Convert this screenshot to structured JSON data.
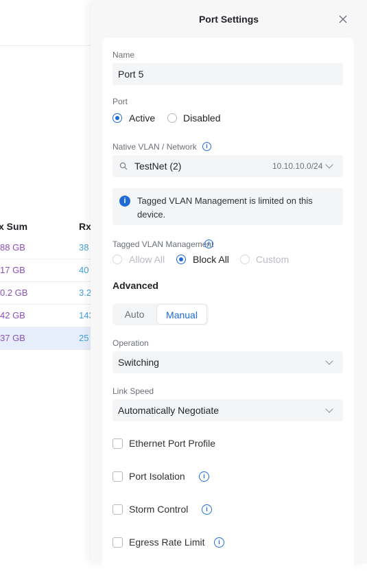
{
  "background_table": {
    "headers": [
      "x Sum",
      "Rx"
    ],
    "rows": [
      {
        "tx": "88 GB",
        "rx": "38"
      },
      {
        "tx": "17 GB",
        "rx": "40"
      },
      {
        "tx": "0.2 GB",
        "rx": "3.2"
      },
      {
        "tx": "42 GB",
        "rx": "143"
      },
      {
        "tx": "37 GB",
        "rx": "25"
      }
    ],
    "selected_row": 4
  },
  "panel": {
    "title": "Port Settings",
    "name_label": "Name",
    "name_value": "Port 5",
    "port_label": "Port",
    "port_options": [
      "Active",
      "Disabled"
    ],
    "port_selected": "Active",
    "vlan_label": "Native VLAN / Network",
    "vlan_value": "TestNet (2)",
    "vlan_subnet": "10.10.10.0/24",
    "notice_text": "Tagged VLAN Management is limited on this device.",
    "tagged_label": "Tagged VLAN Management",
    "tagged_options": [
      "Allow All",
      "Block All",
      "Custom"
    ],
    "tagged_selected": "Block All",
    "advanced_label": "Advanced",
    "advanced_modes": [
      "Auto",
      "Manual"
    ],
    "advanced_selected": "Manual",
    "operation_label": "Operation",
    "operation_value": "Switching",
    "link_speed_label": "Link Speed",
    "link_speed_value": "Automatically Negotiate",
    "checkboxes": [
      {
        "label": "Ethernet Port Profile",
        "info": false,
        "checked": false
      },
      {
        "label": "Port Isolation",
        "info": true,
        "checked": false
      },
      {
        "label": "Storm Control",
        "info": true,
        "checked": false
      },
      {
        "label": "Egress Rate Limit",
        "info": true,
        "checked": false
      }
    ]
  },
  "colors": {
    "accent": "#1e6bd8",
    "tx_text": "#8a4fb8",
    "rx_text": "#3fa0de",
    "selected_row_bg": "#e6eefb"
  }
}
